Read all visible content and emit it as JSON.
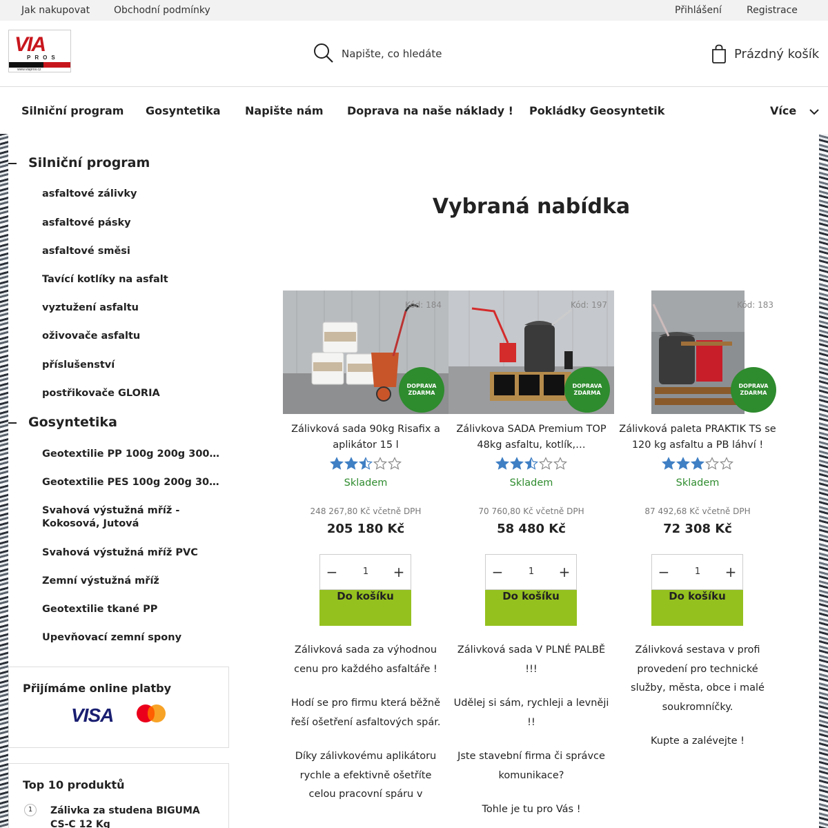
{
  "topbar": {
    "links_left": [
      "Jak nakupovat",
      "Obchodní podmínky"
    ],
    "login": "Přihlášení",
    "register": "Registrace"
  },
  "header": {
    "logo_text": "VIA",
    "logo_sub": "PROS",
    "logo_tagline": "SILNIČNÍ PROGRAM GEOSYNTETIKA",
    "logo_url": "www.viapros.cz",
    "search_placeholder": "Napište, co hledáte",
    "cart_label": "Prázdný košík"
  },
  "nav": {
    "items": [
      "Silniční program",
      "Gosyntetika",
      "Napište nám",
      "Doprava na naše náklady !",
      "Pokládky Geosyntetik"
    ],
    "more": "Více"
  },
  "sidebar": {
    "categories": [
      {
        "label": "Silniční program",
        "items": [
          "asfaltové zálivky",
          "asfaltové pásky",
          "asfaltové směsi",
          "Tavící kotlíky na asfalt",
          "vyztužení asfaltu",
          "oživovače asfaltu",
          "příslušenství",
          "postřikovače GLORIA"
        ]
      },
      {
        "label": "Gosyntetika",
        "items": [
          "Geotextilie PP 100g 200g 300g …",
          "Geotextilie PES 100g 200g 300g …",
          "Svahová výstužná mříž - Kokosová, Jutová",
          "Svahová výstužná mříž PVC",
          "Zemní výstužná mříž",
          "Geotextilie tkané PP",
          "Upevňovací zemní spony"
        ]
      }
    ],
    "payments": {
      "title": "Přijímáme online platby",
      "visa": "VISA"
    },
    "top10": {
      "title": "Top 10 produktů",
      "first_num": "1",
      "first_name": "Zálivka za studena BIGUMA CS-C 12 Kg"
    }
  },
  "main": {
    "title": "Vybraná nabídka",
    "products": [
      {
        "code": "Kód: 184",
        "badge": "DOPRAVA ZDARMA",
        "name": "Zálivková sada 90kg Risafix a aplikátor 15 l",
        "rating": 2.5,
        "stock": "Skladem",
        "old_price": "248 267,80 Kč včetně DPH",
        "price": "205 180 Kč",
        "qty": "1",
        "button": "Do košíku",
        "desc": [
          "Zálivková sada za výhodnou cenu pro každého asfaltáře !",
          "Hodí se pro firmu která běžně řeší ošetření asfaltových spár.",
          "Díky zálivkovému aplikátoru rychle a efektivně ošetříte celou pracovní spáru v"
        ]
      },
      {
        "code": "Kód: 197",
        "badge": "DOPRAVA ZDARMA",
        "name": "Zálivkova SADA Premium TOP 48kg asfaltu, kotlík,…",
        "rating": 2.5,
        "stock": "Skladem",
        "old_price": "70 760,80 Kč včetně DPH",
        "price": "58 480 Kč",
        "qty": "1",
        "button": "Do košíku",
        "desc": [
          "Zálivková sada V PLNÉ PALBĚ !!!",
          "Udělej si sám, rychleji a levněji !!",
          "Jste stavební firma či správce komunikace?",
          "Tohle je tu pro Vás !"
        ]
      },
      {
        "code": "Kód: 183",
        "badge": "DOPRAVA ZDARMA",
        "name": "Zálivková paleta PRAKTIK TS se 120 kg asfaltu a PB láhví !",
        "rating": 3,
        "stock": "Skladem",
        "old_price": "87 492,68 Kč včetně DPH",
        "price": "72 308 Kč",
        "qty": "1",
        "button": "Do košíku",
        "desc": [
          "Zálivková sestava v profi provedení pro technické služby, města, obce i malé soukromníčky.",
          "Kupte a zalévejte !"
        ]
      }
    ]
  },
  "colors": {
    "accent_green": "#95c11f",
    "badge_green": "#2e8b2e",
    "star_blue": "#3f7fc4",
    "brand_red": "#c8161d"
  }
}
